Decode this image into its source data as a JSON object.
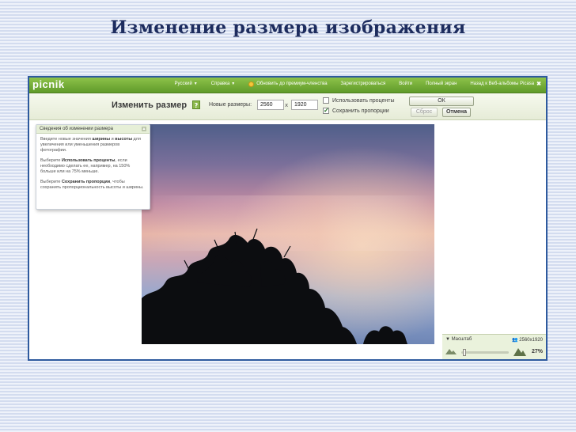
{
  "slide": {
    "title": "Изменение размера изображения"
  },
  "app": {
    "logo": "picnik",
    "nav": [
      {
        "label": "Русский",
        "has_dropdown": true
      },
      {
        "label": "Справка",
        "has_dropdown": true
      },
      {
        "label": "Обновить до премиум-членства",
        "icon": "coin-icon"
      },
      {
        "label": "Зарегистрироваться"
      },
      {
        "label": "Войти"
      },
      {
        "label": "Полный экран"
      },
      {
        "label": "Назад к Веб-альбомы Picasa",
        "icon": "close-icon"
      }
    ],
    "colors": {
      "bar_green": "#6aa834",
      "accent_green": "#8bb84a",
      "frame_border": "#2e5a9e"
    }
  },
  "toolbar": {
    "title": "Изменить размер",
    "help_label": "?",
    "size_label": "Новые размеры:",
    "width_value": "2560",
    "separator": "x",
    "height_value": "1920",
    "use_percent_label": "Использовать проценты",
    "use_percent_checked": false,
    "keep_ratio_label": "Сохранить пропорции",
    "keep_ratio_checked": true,
    "ok_label": "ОК",
    "reset_label": "Сброс",
    "cancel_label": "Отмена"
  },
  "info_panel": {
    "title": "Сведения об изменении размера",
    "p1_before": "Введите новые значения ",
    "p1_bold1": "ширины",
    "p1_mid": " и ",
    "p1_bold2": "высоты",
    "p1_after": " для увеличения или уменьшения размеров фотографии.",
    "p2_before": "Выберите ",
    "p2_bold": "Использовать проценты",
    "p2_after": ", если необходимо сделать ее, например, на 150% больше или на 75% меньше.",
    "p3_before": "Выберите ",
    "p3_bold": "Сохранить пропорции",
    "p3_after": ", чтобы сохранить пропорциональность высоты и ширины."
  },
  "zoom": {
    "label": "Масштаб",
    "resolution": "2560x1920",
    "percent": "27%",
    "level": 0.27
  }
}
